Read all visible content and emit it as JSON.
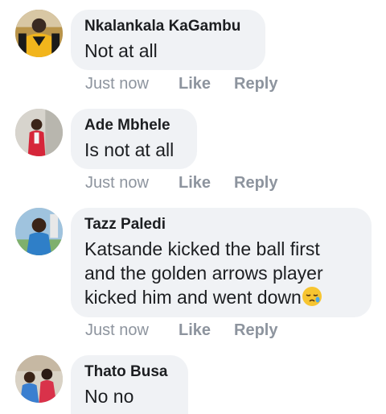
{
  "comments": [
    {
      "author": "Nkalankala KaGambu",
      "text": "Not at all",
      "time": "Just now",
      "like": "Like",
      "reply": "Reply"
    },
    {
      "author": "Ade Mbhele",
      "text": "Is not at all",
      "time": "Just now",
      "like": "Like",
      "reply": "Reply"
    },
    {
      "author": "Tazz Paledi",
      "text_lines": [
        "Katsande kicked the ball first",
        "and the golden arrows player",
        "kicked him and went down"
      ],
      "emoji": "sleepy-face-emoji",
      "time": "Just now",
      "like": "Like",
      "reply": "Reply"
    },
    {
      "author": "Thato Busa",
      "text": "No no"
    }
  ],
  "colors": {
    "bubble": "#f0f2f5",
    "text": "#1c1e21",
    "meta": "#8d949e"
  }
}
